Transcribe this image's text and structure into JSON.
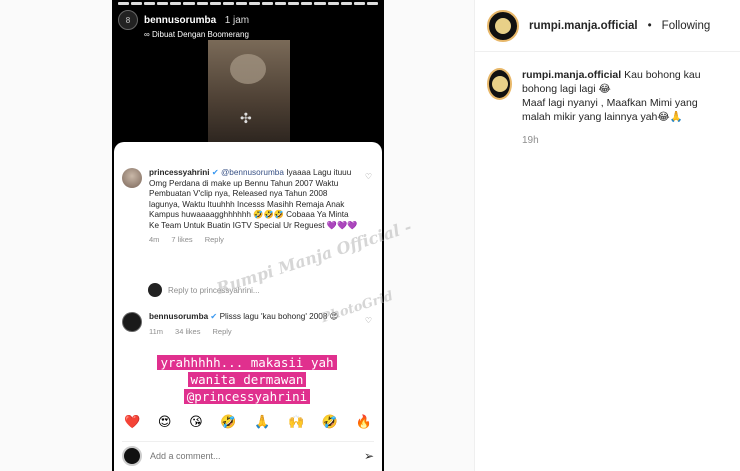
{
  "story": {
    "username": "bennusorumba",
    "time": "1 jam",
    "subtitle": "Dibuat Dengan Boomerang"
  },
  "comments": [
    {
      "username": "princessyahrini",
      "mention": "@bennusorumba",
      "text": "Iyaaaa Lagu ituuu Omg Perdana di make up Bennu Tahun 2007 Waktu Pembuatan V'clip nya, Released nya Tahun 2008 lagunya, Waktu Ituuhhh Incesss Masihh Remaja Anak Kampus huwaaaagghhhhhh 🤣🤣🤣 Cobaaa Ya Minta Ke Team Untuk Buatin IGTV Special Ur Reguest",
      "emoji_tail": "💜💜💜",
      "age": "4m",
      "likes": "7 likes",
      "reply": "Reply"
    },
    {
      "username": "bennusorumba",
      "text": "Plisss lagu 'kau bohong' 2008 😍",
      "age": "11m",
      "likes": "34 likes",
      "reply": "Reply"
    }
  ],
  "reply_to": "Reply to princessyahrini...",
  "highlight_text": "yrahhhhh... makasii yah wanita dermawan @princessyahrini",
  "emoji_bar": [
    "❤️",
    "😍",
    "😘",
    "🤣",
    "🙏",
    "🙌",
    "🤣",
    "🔥"
  ],
  "comment_input": {
    "placeholder": "Add a comment..."
  },
  "watermark": {
    "line1": "Rumpi Manja Official -",
    "line2": "PhotoGrid"
  },
  "sidebar": {
    "account": "rumpi.manja.official",
    "dot": "•",
    "follow_state": "Following",
    "caption_user": "rumpi.manja.official",
    "caption_line1": "Kau bohong kau bohong lagi lagi 😂",
    "caption_line2": "Maaf lagi nyanyi , Maafkan Mimi yang malah mikir yang lainnya yah😂🙏",
    "time_ago": "19h"
  }
}
